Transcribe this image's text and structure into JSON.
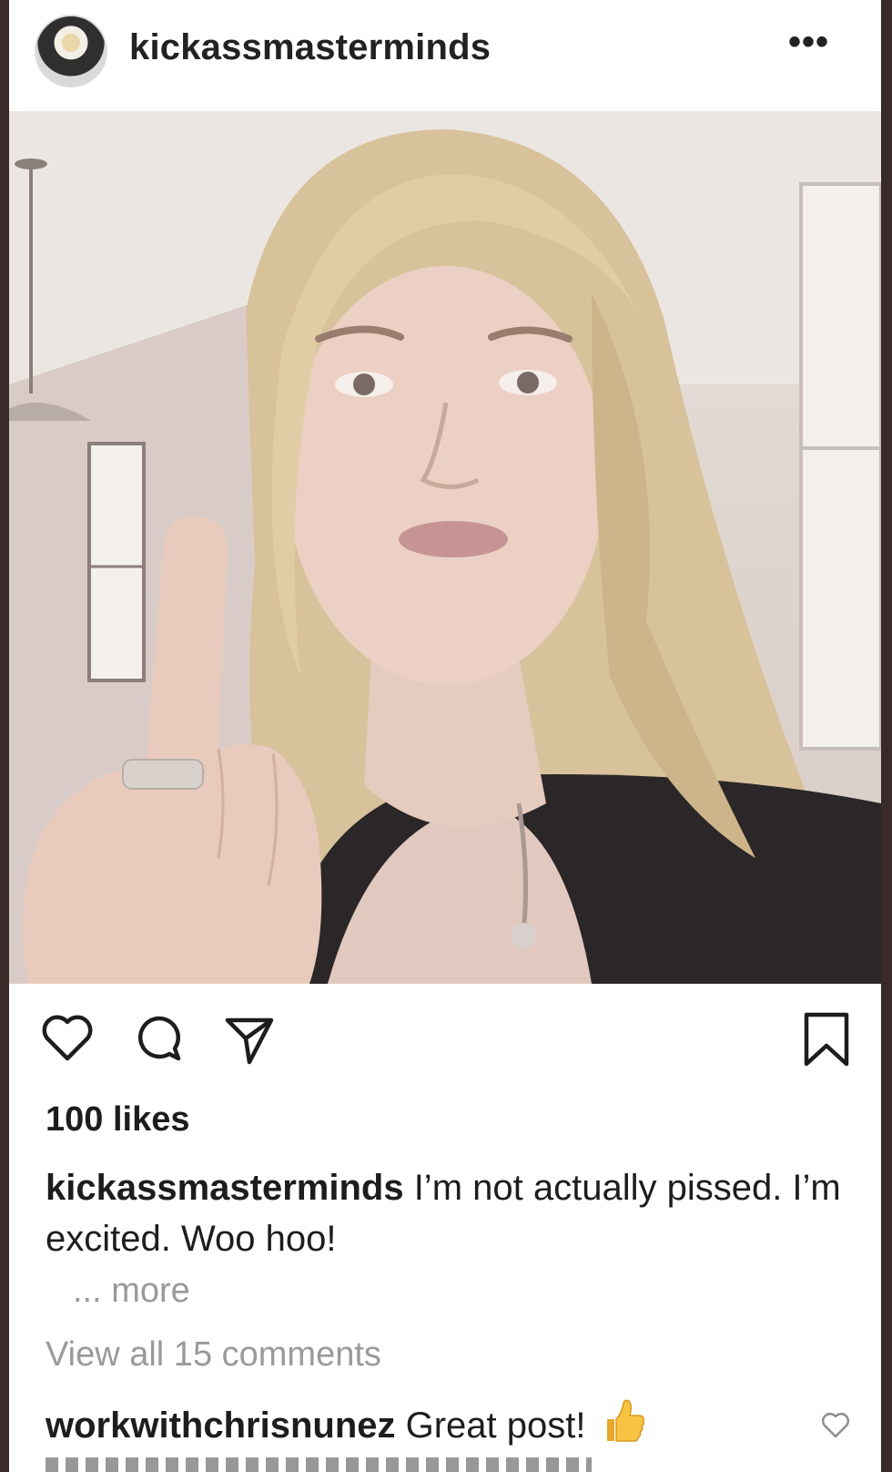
{
  "post": {
    "username": "kickassmasterminds",
    "more_menu": "•••"
  },
  "actions": {
    "like_icon": "heart-icon",
    "comment_icon": "comment-icon",
    "share_icon": "share-icon",
    "save_icon": "bookmark-icon"
  },
  "likes": "100 likes",
  "caption": {
    "user": "kickassmasterminds",
    "text": " I’m not actually pissed. I’m excited. Woo hoo!"
  },
  "more_link": "... more",
  "view_comments": "View all 15 comments",
  "comments": [
    {
      "user": "workwithchrisnunez",
      "text": " Great post!",
      "emoji": "thumbs-up-icon"
    }
  ],
  "colors": {
    "text": "#1d1d1d",
    "muted": "#9a9a9a",
    "border": "#3a2a2a"
  }
}
